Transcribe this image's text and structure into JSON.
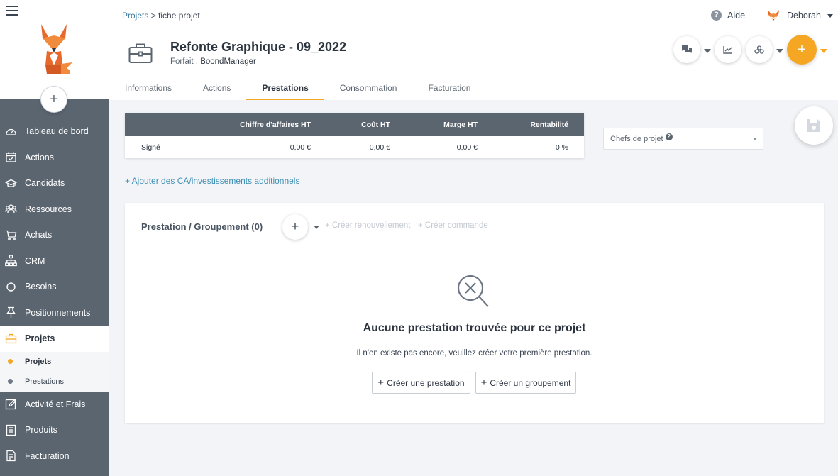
{
  "sidebar": {
    "add_label": "+",
    "items": [
      {
        "label": "Tableau de bord",
        "icon": "dashboard-icon"
      },
      {
        "label": "Actions",
        "icon": "calendar-check-icon"
      },
      {
        "label": "Candidats",
        "icon": "graduation-cap-icon"
      },
      {
        "label": "Ressources",
        "icon": "people-icon"
      },
      {
        "label": "Achats",
        "icon": "cart-icon"
      },
      {
        "label": "CRM",
        "icon": "org-chart-icon"
      },
      {
        "label": "Besoins",
        "icon": "crosshair-icon"
      },
      {
        "label": "Positionnements",
        "icon": "pin-icon"
      },
      {
        "label": "Projets",
        "icon": "briefcase-icon",
        "active": true
      },
      {
        "label": "Activité et Frais",
        "icon": "pencil-square-icon"
      },
      {
        "label": "Produits",
        "icon": "document-icon"
      },
      {
        "label": "Facturation",
        "icon": "invoice-icon"
      }
    ],
    "sub_items": [
      {
        "label": "Projets",
        "active": true
      },
      {
        "label": "Prestations",
        "active": false
      }
    ]
  },
  "header": {
    "breadcrumb_link": "Projets",
    "breadcrumb_sep": " > ",
    "breadcrumb_current": "fiche projet",
    "help_label": "Aide",
    "user_name": "Deborah",
    "project_title": "Refonte Graphique - 09_2022",
    "project_type": "Forfait , ",
    "project_company": "BoondManager",
    "add_label": "+"
  },
  "tabs": [
    {
      "label": "Informations",
      "active": false
    },
    {
      "label": "Actions",
      "active": false
    },
    {
      "label": "Prestations",
      "active": true
    },
    {
      "label": "Consommation",
      "active": false
    },
    {
      "label": "Facturation",
      "active": false
    }
  ],
  "financials": {
    "headers": [
      "",
      "Chiffre d'affaires HT",
      "Coût HT",
      "Marge HT",
      "Rentabilité"
    ],
    "row": [
      "Signé",
      "0,00 €",
      "0,00 €",
      "0,00 €",
      "0 %"
    ]
  },
  "chefs_projet": {
    "label": "Chefs de projet",
    "help": "?"
  },
  "add_ca_link": "+ Ajouter des CA/investissements additionnels",
  "prestations": {
    "title": "Prestation / Groupement (0)",
    "add_label": "+",
    "renouvellement": "+ Créer renouvellement",
    "commande": "+ Créer commande",
    "empty_title": "Aucune prestation trouvée pour ce projet",
    "empty_desc": "Il n'en existe pas encore, veuillez créer votre première prestation.",
    "btn_prestation": "Créer une prestation",
    "btn_groupement": "Créer un groupement",
    "btn_plus": "+"
  },
  "colors": {
    "accent": "#f5a623",
    "sidebar": "#5b6570",
    "link": "#3d8fb5"
  }
}
